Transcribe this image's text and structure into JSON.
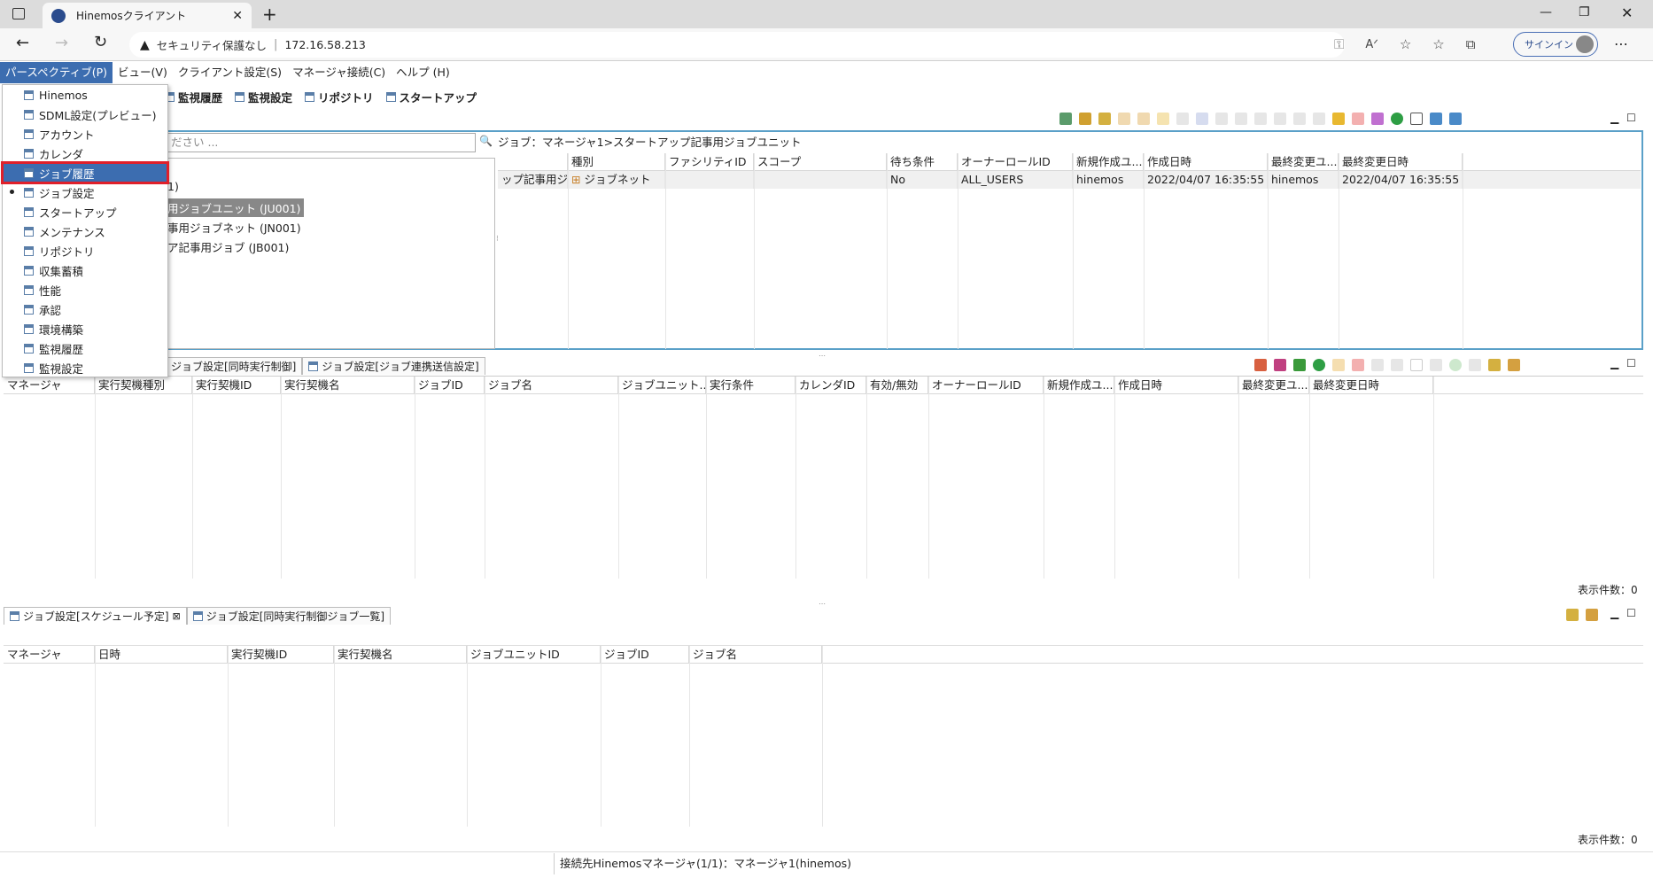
{
  "browser": {
    "tab_title": "Hinemosクライアント",
    "address_security": "セキュリティ保護なし",
    "address_url": "172.16.58.213",
    "signin_label": "サインイン"
  },
  "menu": {
    "items": [
      "パースペクティブ(P)",
      "ビュー(V)",
      "クライアント設定(S)",
      "マネージャ接続(C)",
      "ヘルプ (H)"
    ]
  },
  "perspective_bar": {
    "items": [
      "監視履歴",
      "監視設定",
      "リポジトリ",
      "スタートアップ"
    ]
  },
  "dropdown": {
    "items": [
      "Hinemos",
      "SDML設定(プレビュー)",
      "アカウント",
      "カレンダ",
      "ジョブ履歴",
      "ジョブ設定",
      "スタートアップ",
      "メンテナンス",
      "リポジトリ",
      "収集蓄積",
      "性能",
      "承認",
      "環境構築",
      "監視履歴",
      "監視設定"
    ],
    "selected": "ジョブ履歴",
    "current": "ジョブ設定"
  },
  "tree": {
    "filter_placeholder": "ださい ...",
    "node0": "1)",
    "node1": "用ジョブユニット (JU001)",
    "node2": "事用ジョブネット (JN001)",
    "node3": "ア記事用ジョブ (JB001)"
  },
  "job_list": {
    "breadcrumb": "ジョブ：マネージャ1>スタートアップ記事用ジョブユニット",
    "columns": [
      "",
      "種別",
      "ファシリティID",
      "スコープ",
      "待ち条件",
      "オーナーロールID",
      "新規作成ユ...",
      "作成日時",
      "最終変更ユ...",
      "最終変更日時"
    ],
    "row": [
      "ップ記事用ジ...",
      "ジョブネット",
      "",
      "",
      "No",
      "ALL_USERS",
      "hinemos",
      "2022/04/07 16:35:55",
      "hinemos",
      "2022/04/07 16:35:55"
    ]
  },
  "middle_panel": {
    "tabs": [
      "ジョブ設定[同時実行制御]",
      "ジョブ設定[ジョブ連携送信設定]"
    ],
    "columns": [
      "マネージャ",
      "実行契機種別",
      "実行契機ID",
      "実行契機名",
      "ジョブID",
      "ジョブ名",
      "ジョブユニット...",
      "実行条件",
      "カレンダID",
      "有効/無効",
      "オーナーロールID",
      "新規作成ユ...",
      "作成日時",
      "最終変更ユ...",
      "最終変更日時"
    ],
    "count_label": "表示件数：0"
  },
  "bottom_panel": {
    "tabs": [
      "ジョブ設定[スケジュール予定]",
      "ジョブ設定[同時実行制御ジョブ一覧]"
    ],
    "columns": [
      "マネージャ",
      "日時",
      "実行契機ID",
      "実行契機名",
      "ジョブユニットID",
      "ジョブID",
      "ジョブ名"
    ],
    "count_label": "表示件数：0"
  },
  "status_bar": {
    "text": "接続先Hinemosマネージャ(1/1)：マネージャ1(hinemos)"
  }
}
